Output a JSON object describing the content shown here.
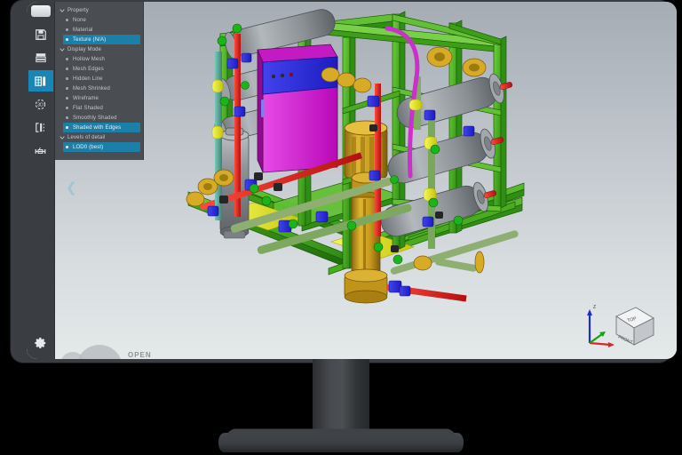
{
  "app": {
    "kind": "cad-3d-viewer",
    "device": "desktop-monitor-mockup"
  },
  "toolbar": {
    "logo_name": "app-logo",
    "buttons": [
      {
        "id": "save",
        "label": "Save",
        "icon": "floppy-disk-icon",
        "active": false
      },
      {
        "id": "structure",
        "label": "Model Structure",
        "icon": "layers-list-icon",
        "active": false
      },
      {
        "id": "appearance",
        "label": "Appearance",
        "icon": "appearance-icon",
        "active": true
      },
      {
        "id": "rotate3d",
        "label": "3D Rotate",
        "icon": "rotate-3d-icon",
        "active": false
      },
      {
        "id": "section",
        "label": "Section View",
        "icon": "section-view-icon",
        "active": false
      },
      {
        "id": "measure",
        "label": "Measure",
        "icon": "measure-icon",
        "active": false
      }
    ],
    "settings_label": "Settings",
    "settings_icon": "gear-icon"
  },
  "panel": {
    "collapse_icon": "chevron-left-icon",
    "groups": [
      {
        "label": "Property",
        "expanded": true,
        "items": [
          {
            "label": "None",
            "selected": false
          },
          {
            "label": "Material",
            "selected": false
          },
          {
            "label": "Texture (N/A)",
            "selected": true
          }
        ]
      },
      {
        "label": "Display Mode",
        "expanded": true,
        "items": [
          {
            "label": "Hollow Mesh",
            "selected": false
          },
          {
            "label": "Mesh Edges",
            "selected": false
          },
          {
            "label": "Hidden Line",
            "selected": false
          },
          {
            "label": "Mesh Shrinked",
            "selected": false
          },
          {
            "label": "Wireframe",
            "selected": false
          },
          {
            "label": "Flat Shaded",
            "selected": false
          },
          {
            "label": "Smoothly Shaded",
            "selected": false
          },
          {
            "label": "Shaded with Edges",
            "selected": true
          }
        ]
      },
      {
        "label": "Levels of detail",
        "expanded": true,
        "items": [
          {
            "label": "LOD0 (best)",
            "selected": true
          }
        ]
      }
    ]
  },
  "statusbar": {
    "open_label": "OPEN"
  },
  "viewcube": {
    "top_face_label": "TOP",
    "front_face_label": "FRONT",
    "axis_z_label": "Z",
    "axis_colors": {
      "x": "#d42a2a",
      "y": "#17a017",
      "z": "#1b2fc8"
    }
  },
  "colors": {
    "accent": "#1787b8",
    "selection": "#1b7fa8",
    "toolbar_bg": "#3a3d42",
    "panel_bg": "#4a4d52",
    "viewport_top": "#a6acb4",
    "viewport_bottom": "#e4e9e9",
    "bezel": "#3a3d42",
    "model_frame_green": "#3faa1e",
    "model_pump_gold": "#c79a1e",
    "model_vessel_grey": "#8a8f94",
    "model_cabinet_magenta": "#d916d9",
    "model_cabinet_blue": "#2222dd",
    "model_pipe_red": "#e01b1b",
    "model_pipe_teal": "#54a89a",
    "model_valve_blue": "#1230d8",
    "model_yellow": "#e8e81a"
  },
  "model": {
    "name": "industrial-pump-skid-assembly",
    "description": "3D shaded CAD assembly of a water treatment / pumping skid"
  }
}
